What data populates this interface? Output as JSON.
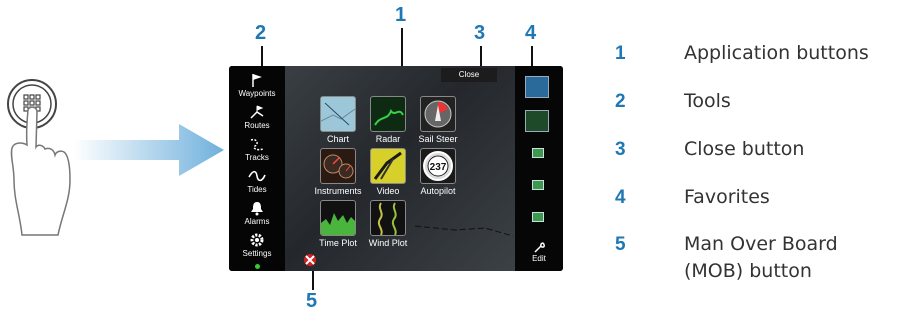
{
  "callouts": {
    "c1": "1",
    "c2": "2",
    "c3": "3",
    "c4": "4",
    "c5": "5"
  },
  "screen": {
    "close_label": "Close",
    "tools": [
      {
        "label": "Waypoints",
        "icon": "flag-icon"
      },
      {
        "label": "Routes",
        "icon": "routes-icon"
      },
      {
        "label": "Tracks",
        "icon": "tracks-icon"
      },
      {
        "label": "Tides",
        "icon": "tides-icon"
      },
      {
        "label": "Alarms",
        "icon": "bell-icon"
      },
      {
        "label": "Settings",
        "icon": "gear-icon"
      }
    ],
    "apps": [
      {
        "label": "Chart",
        "icon": "chart-app-icon"
      },
      {
        "label": "Radar",
        "icon": "radar-app-icon"
      },
      {
        "label": "Sail Steer",
        "icon": "sail-steer-app-icon"
      },
      {
        "label": "Instruments",
        "icon": "instruments-app-icon"
      },
      {
        "label": "Video",
        "icon": "video-app-icon"
      },
      {
        "label": "Autopilot",
        "icon": "autopilot-app-icon"
      },
      {
        "label": "Time Plot",
        "icon": "time-plot-app-icon"
      },
      {
        "label": "Wind Plot",
        "icon": "wind-plot-app-icon"
      }
    ],
    "autopilot_value": "237",
    "edit_label": "Edit"
  },
  "legend": [
    {
      "num": "1",
      "text": "Application buttons"
    },
    {
      "num": "2",
      "text": "Tools"
    },
    {
      "num": "3",
      "text": "Close button"
    },
    {
      "num": "4",
      "text": "Favorites"
    },
    {
      "num": "5",
      "text": "Man Over Board\n(MOB) button"
    }
  ],
  "colors": {
    "callout": "#1f78b4",
    "arrow": "#6fb0dc"
  }
}
